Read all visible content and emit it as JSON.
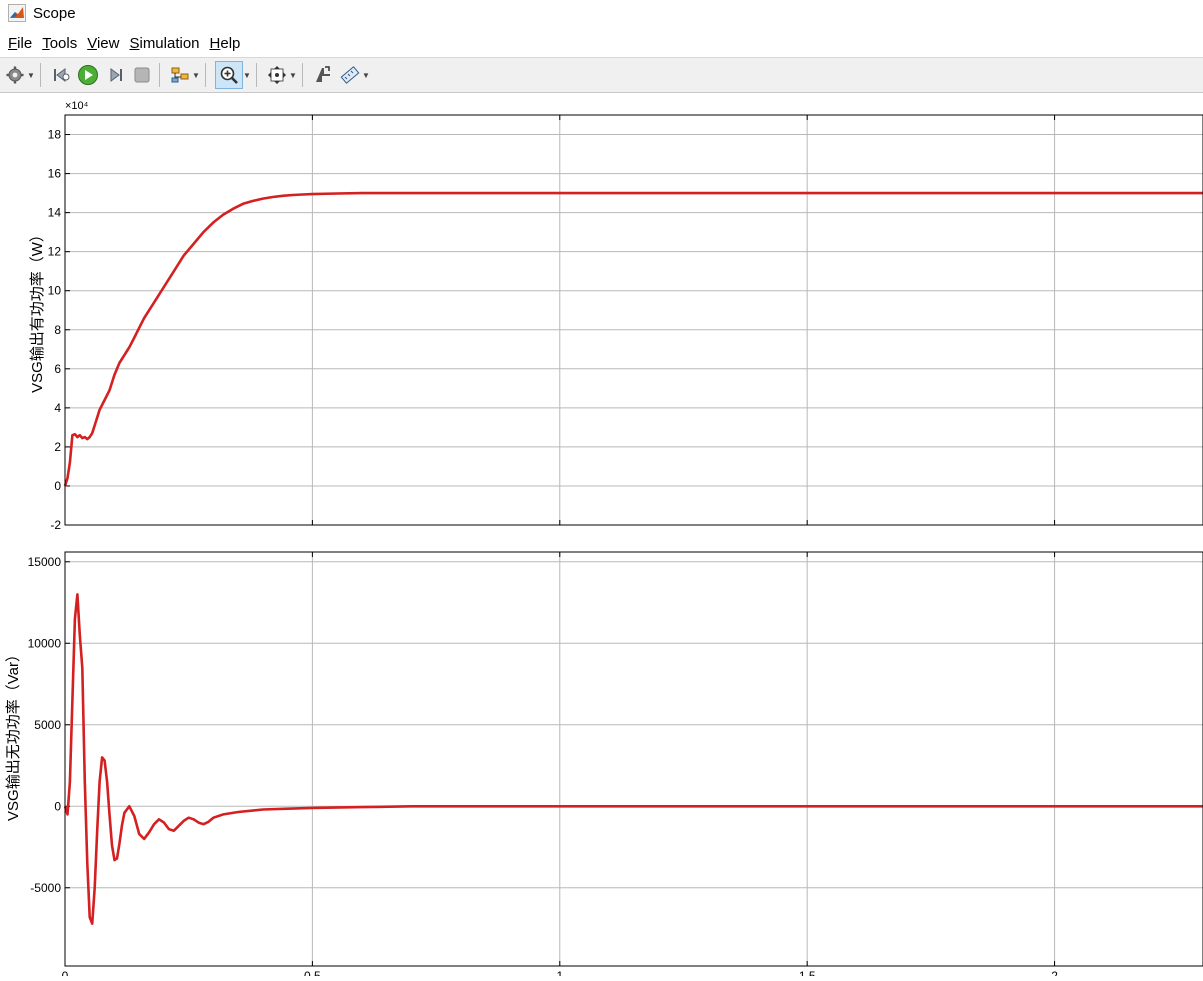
{
  "window": {
    "title": "Scope"
  },
  "menu": [
    {
      "label": "File"
    },
    {
      "label": "Tools"
    },
    {
      "label": "View"
    },
    {
      "label": "Simulation"
    },
    {
      "label": "Help"
    }
  ],
  "toolbar": {
    "icons": [
      "gear-icon",
      "step-back-icon",
      "run-icon",
      "step-forward-icon",
      "stop-icon",
      "highlight-icon",
      "zoom-in-icon",
      "fit-to-view-icon",
      "restore-icon",
      "measure-icon"
    ],
    "zoom_active_color": "#cde6f7"
  },
  "colors": {
    "signal": "#d42020",
    "grid": "#b8b8b8",
    "axis": "#000000"
  },
  "chart_data": [
    {
      "type": "line",
      "ylabel": "VSG输出有功功率（W）",
      "exponent_label": "×10⁴",
      "ylim": [
        -2,
        19
      ],
      "yticks": [
        -2,
        0,
        2,
        4,
        6,
        8,
        10,
        12,
        14,
        16,
        18
      ],
      "xlim": [
        0,
        2.3
      ],
      "xticks": [
        0,
        0.5,
        1,
        1.5,
        2
      ],
      "grid": true,
      "series": [
        {
          "x": [
            0,
            0.005,
            0.01,
            0.015,
            0.02,
            0.025,
            0.03,
            0.035,
            0.04,
            0.045,
            0.05,
            0.055,
            0.06,
            0.07,
            0.08,
            0.09,
            0.1,
            0.11,
            0.12,
            0.13,
            0.14,
            0.15,
            0.16,
            0.18,
            0.2,
            0.22,
            0.24,
            0.26,
            0.28,
            0.3,
            0.32,
            0.34,
            0.36,
            0.38,
            0.4,
            0.42,
            0.44,
            0.46,
            0.48,
            0.5,
            0.55,
            0.6,
            0.65,
            0.7,
            0.8,
            1.0,
            1.2,
            1.4,
            1.6,
            1.8,
            2.0,
            2.3
          ],
          "values": [
            0,
            0.4,
            1.2,
            2.6,
            2.65,
            2.5,
            2.6,
            2.45,
            2.5,
            2.4,
            2.5,
            2.7,
            3.1,
            3.9,
            4.4,
            4.9,
            5.7,
            6.3,
            6.7,
            7.1,
            7.6,
            8.1,
            8.6,
            9.4,
            10.2,
            11.0,
            11.8,
            12.4,
            13.0,
            13.5,
            13.9,
            14.2,
            14.45,
            14.6,
            14.72,
            14.8,
            14.86,
            14.9,
            14.93,
            14.95,
            14.98,
            15.0,
            15.0,
            15.0,
            15.0,
            15.0,
            15.0,
            15.0,
            15.0,
            15.0,
            15.0,
            15.0
          ]
        }
      ]
    },
    {
      "type": "line",
      "ylabel": "VSG输出无功功率（Var）",
      "ylim": [
        -9800,
        15600
      ],
      "yticks": [
        -5000,
        0,
        5000,
        10000,
        15000
      ],
      "xlim": [
        0,
        2.3
      ],
      "xticks": [
        0,
        0.5,
        1,
        1.5,
        2
      ],
      "xticklabels": [
        "0",
        "0.5",
        "1",
        "1.5",
        "2"
      ],
      "grid": true,
      "series": [
        {
          "x": [
            0,
            0.005,
            0.01,
            0.015,
            0.02,
            0.025,
            0.03,
            0.035,
            0.04,
            0.045,
            0.05,
            0.055,
            0.06,
            0.065,
            0.07,
            0.075,
            0.08,
            0.085,
            0.09,
            0.095,
            0.1,
            0.105,
            0.11,
            0.115,
            0.12,
            0.13,
            0.14,
            0.15,
            0.16,
            0.17,
            0.18,
            0.19,
            0.2,
            0.21,
            0.22,
            0.23,
            0.24,
            0.25,
            0.26,
            0.27,
            0.28,
            0.29,
            0.3,
            0.32,
            0.35,
            0.4,
            0.45,
            0.5,
            0.6,
            0.7,
            0.8,
            1.0,
            1.2,
            1.4,
            1.6,
            1.8,
            2.0,
            2.3
          ],
          "values": [
            0,
            -500,
            1500,
            6500,
            11500,
            13000,
            10500,
            8500,
            1500,
            -3500,
            -6800,
            -7200,
            -5000,
            -1500,
            1500,
            3000,
            2800,
            1500,
            -500,
            -2400,
            -3300,
            -3200,
            -2300,
            -1200,
            -400,
            0,
            -600,
            -1700,
            -2000,
            -1600,
            -1100,
            -800,
            -1000,
            -1400,
            -1500,
            -1200,
            -900,
            -700,
            -800,
            -1000,
            -1100,
            -950,
            -700,
            -500,
            -350,
            -200,
            -150,
            -100,
            -50,
            0,
            0,
            0,
            0,
            0,
            0,
            0,
            0,
            0
          ]
        }
      ]
    }
  ]
}
